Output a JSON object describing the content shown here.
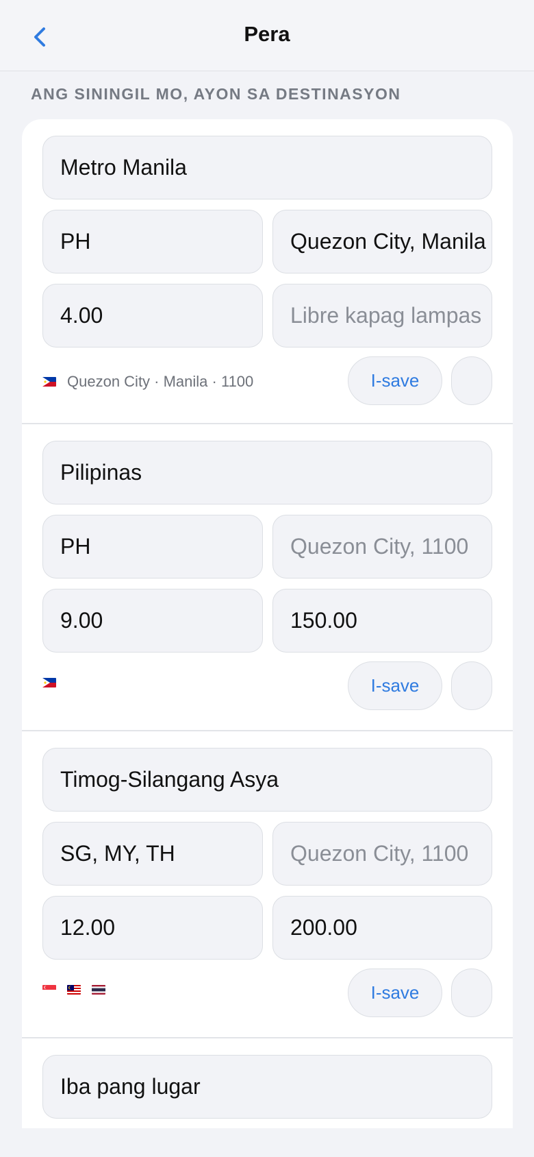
{
  "nav": {
    "title": "Pera"
  },
  "section": {
    "header": "ANG SININGIL MO, AYON SA DESTINASYON"
  },
  "regions": [
    {
      "name": "Metro Manila",
      "countries": "PH",
      "cities": "Quezon City, Manila",
      "cities_is_placeholder": false,
      "rate": "4.00",
      "free_threshold": "Libre kapag lampas",
      "free_is_placeholder": true,
      "flags": [
        "PH"
      ],
      "meta": "Quezon City · Manila · 1100",
      "save_label": "I-save"
    },
    {
      "name": "Pilipinas",
      "countries": "PH",
      "cities": "Quezon City, 1100",
      "cities_is_placeholder": true,
      "rate": "9.00",
      "free_threshold": "150.00",
      "free_is_placeholder": false,
      "flags": [
        "PH"
      ],
      "meta": "",
      "save_label": "I-save"
    },
    {
      "name": "Timog-Silangang Asya",
      "countries": "SG, MY, TH",
      "cities": "Quezon City, 1100",
      "cities_is_placeholder": true,
      "rate": "12.00",
      "free_threshold": "200.00",
      "free_is_placeholder": false,
      "flags": [
        "SG",
        "MY",
        "TH"
      ],
      "meta": "",
      "save_label": "I-save"
    },
    {
      "name": "Iba pang lugar"
    }
  ],
  "colors": {
    "accent": "#2f7be0",
    "background": "#f2f3f7",
    "card": "#ffffff"
  }
}
